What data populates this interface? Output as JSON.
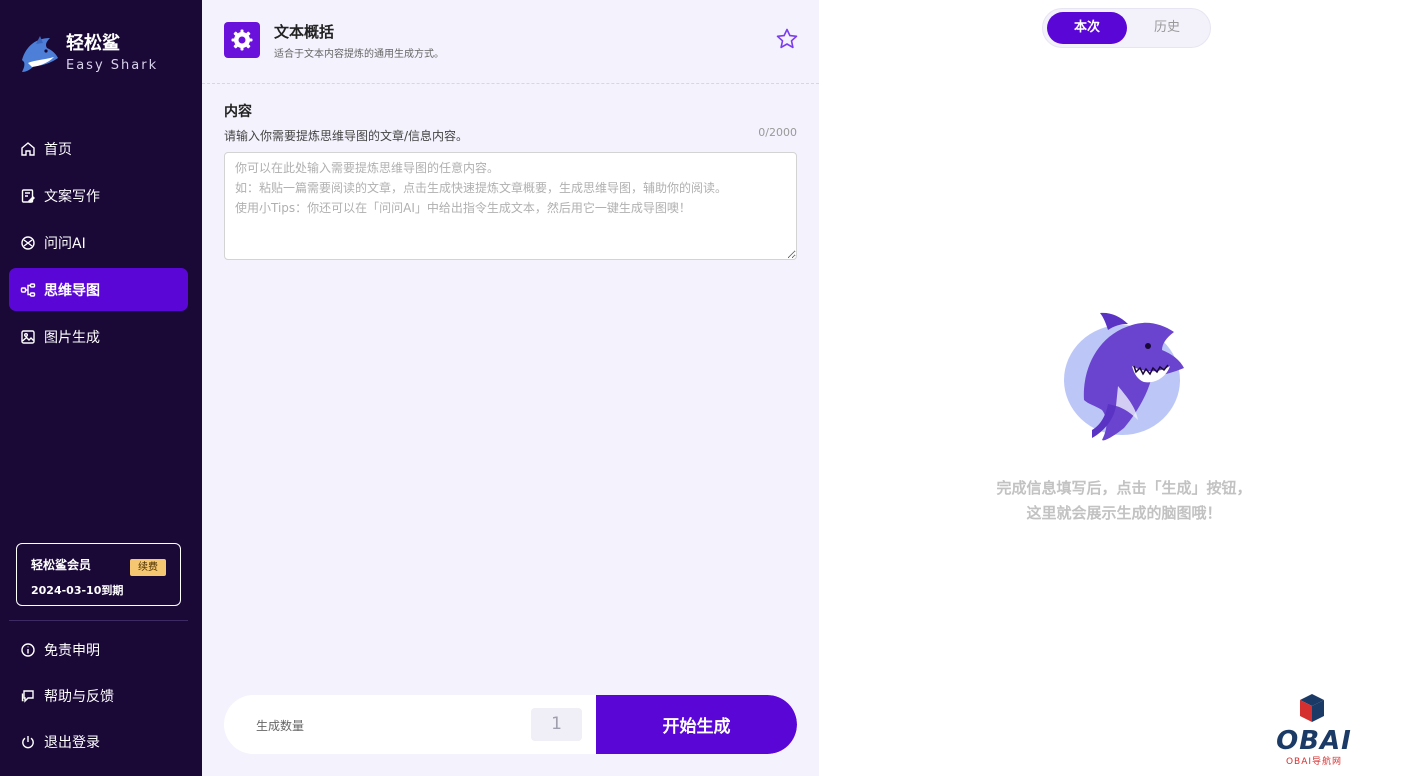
{
  "brand": {
    "name": "轻松鲨",
    "subtitle": "Easy Shark"
  },
  "nav": {
    "items": [
      {
        "label": "首页",
        "icon": "home-icon"
      },
      {
        "label": "文案写作",
        "icon": "document-edit-icon"
      },
      {
        "label": "问问AI",
        "icon": "ai-chat-icon"
      },
      {
        "label": "思维导图",
        "icon": "mindmap-icon",
        "active": true
      },
      {
        "label": "图片生成",
        "icon": "image-icon"
      }
    ]
  },
  "membership": {
    "title": "轻松鲨会员",
    "expiry": "2024-03-10到期",
    "renew_label": "续费"
  },
  "bottom_nav": {
    "items": [
      {
        "label": "免责申明",
        "icon": "info-icon"
      },
      {
        "label": "帮助与反馈",
        "icon": "feedback-icon"
      },
      {
        "label": "退出登录",
        "icon": "power-icon"
      }
    ]
  },
  "tool": {
    "title": "文本概括",
    "description": "适合于文本内容提炼的通用生成方式。",
    "icon": "gear-icon"
  },
  "content": {
    "label": "内容",
    "hint": "请输入你需要提炼思维导图的文章/信息内容。",
    "char_count": "0/2000",
    "value": "",
    "placeholder": "你可以在此处输入需要提炼思维导图的任意内容。\n如：粘贴一篇需要阅读的文章，点击生成快速提炼文章概要，生成思维导图，辅助你的阅读。\n使用小Tips：你还可以在「问问AI」中给出指令生成文本，然后用它一键生成导图噢！"
  },
  "generate": {
    "quantity_label": "生成数量",
    "quantity_value": "1",
    "start_label": "开始生成"
  },
  "result": {
    "tabs": [
      {
        "label": "本次",
        "active": true
      },
      {
        "label": "历史",
        "active": false
      }
    ],
    "empty_line1": "完成信息填写后，点击「生成」按钮，",
    "empty_line2": "这里就会展示生成的脑图哦！"
  },
  "watermark": {
    "text": "OBAI",
    "sub": "OBAI导航网"
  },
  "colors": {
    "sidebar_bg": "#1a0837",
    "accent": "#5a06d7",
    "panel_bg": "#f4f2fc",
    "badge": "#f5c771"
  }
}
